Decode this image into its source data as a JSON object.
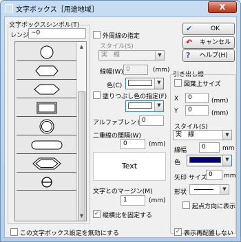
{
  "window": {
    "title": "文字ボックス［用途地域］",
    "close_label": "X"
  },
  "left": {
    "symbol_group_label": "文字ボックスシンボル(T)",
    "layer_label": "レンジ",
    "layer_value": "~0",
    "symbols": [
      "circle",
      "hexagon-rounded",
      "hexagon",
      "rectangle-double",
      "circle-double",
      "rounded-rect",
      "hexagon-double",
      "theta"
    ]
  },
  "style_panel": {
    "outer_border_label": "外周線の指定",
    "style_label": "スタイル(S)",
    "style_value": "実　線",
    "width_label": "線幅(W)",
    "width_value": "0",
    "width_unit": "(mm)",
    "color_label": "色(C)",
    "fill_label": "塗りつぶし色の指定(F)",
    "alpha_label": "アルファブレンド",
    "alpha_value": "0",
    "double_gap_label": "二重線の間隔(W)",
    "double_gap_value": "0",
    "double_gap_unit": "(mm)",
    "preview_text": "Text",
    "margin_label": "文字とのマージン(M)",
    "margin_value": "1",
    "margin_unit": "(mm)",
    "fix_ratio_label": "縦横比を固定する",
    "fix_ratio_checked": true
  },
  "buttons": {
    "ok": "OK",
    "cancel": "キャンセル",
    "help": "ヘルプ(H)"
  },
  "leader": {
    "group_label": "引き出し線",
    "above_size_label": "図葉上サイズ",
    "x_label": "X",
    "x_value": "0",
    "y_label": "Y",
    "y_value": "0",
    "unit": "(mm)",
    "style_label": "スタイル(S)",
    "style_value": "実　線",
    "width_label": "線幅",
    "width_value": "0",
    "width_unit": "mm",
    "color_label": "色",
    "arrow_size_label": "矢印 サイズ",
    "arrow_size_value": "0",
    "arrow_size_unit": "mm",
    "shape_label": "形状",
    "start_direction_label": "起点方向に表示"
  },
  "footer": {
    "disable_label": "この文字ボックス設定を無効にする",
    "disable_checked": false,
    "no_rearrange_label": "表示再配置しない",
    "no_rearrange_checked": true
  },
  "colors": {
    "accent_blue": "#1f4fd1",
    "title_bg": "#c6ddf3",
    "close_red": "#c75b3f",
    "leader_color": "#000080"
  }
}
